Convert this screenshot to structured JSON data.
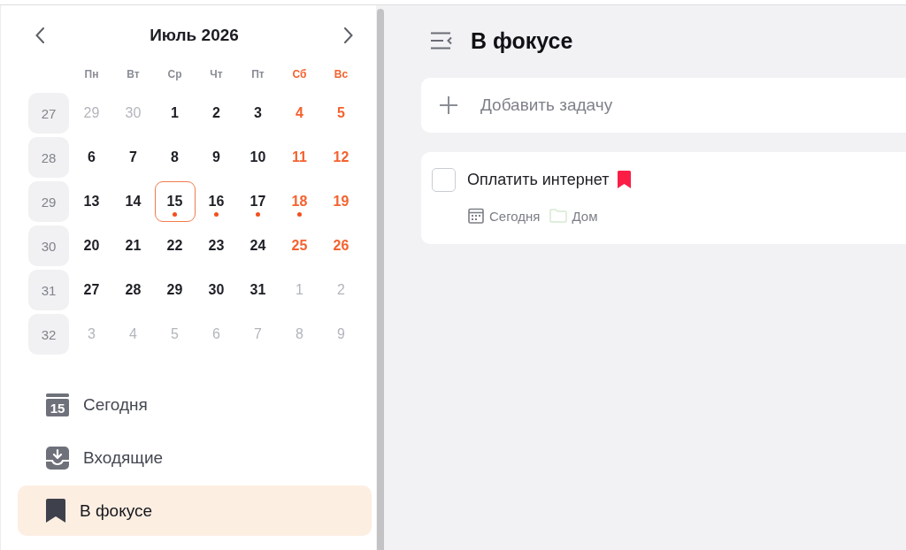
{
  "calendar": {
    "title": "Июль 2026",
    "weekdays": [
      {
        "label": "Пн",
        "kind": "weekday"
      },
      {
        "label": "Вт",
        "kind": "weekday"
      },
      {
        "label": "Ср",
        "kind": "weekday"
      },
      {
        "label": "Чт",
        "kind": "weekday"
      },
      {
        "label": "Пт",
        "kind": "weekday"
      },
      {
        "label": "Сб",
        "kind": "weekend"
      },
      {
        "label": "Вс",
        "kind": "weekend"
      }
    ],
    "weeks": [
      {
        "number": "27",
        "days": [
          {
            "label": "29",
            "kind": "other",
            "selected": false,
            "has_tasks": false
          },
          {
            "label": "30",
            "kind": "other",
            "selected": false,
            "has_tasks": false
          },
          {
            "label": "1",
            "kind": "weekday",
            "selected": false,
            "has_tasks": false
          },
          {
            "label": "2",
            "kind": "weekday",
            "selected": false,
            "has_tasks": false
          },
          {
            "label": "3",
            "kind": "weekday",
            "selected": false,
            "has_tasks": false
          },
          {
            "label": "4",
            "kind": "weekend",
            "selected": false,
            "has_tasks": false
          },
          {
            "label": "5",
            "kind": "weekend",
            "selected": false,
            "has_tasks": false
          }
        ]
      },
      {
        "number": "28",
        "days": [
          {
            "label": "6",
            "kind": "weekday",
            "selected": false,
            "has_tasks": false
          },
          {
            "label": "7",
            "kind": "weekday",
            "selected": false,
            "has_tasks": false
          },
          {
            "label": "8",
            "kind": "weekday",
            "selected": false,
            "has_tasks": false
          },
          {
            "label": "9",
            "kind": "weekday",
            "selected": false,
            "has_tasks": false
          },
          {
            "label": "10",
            "kind": "weekday",
            "selected": false,
            "has_tasks": false
          },
          {
            "label": "11",
            "kind": "weekend",
            "selected": false,
            "has_tasks": false
          },
          {
            "label": "12",
            "kind": "weekend",
            "selected": false,
            "has_tasks": false
          }
        ]
      },
      {
        "number": "29",
        "days": [
          {
            "label": "13",
            "kind": "weekday",
            "selected": false,
            "has_tasks": false
          },
          {
            "label": "14",
            "kind": "weekday",
            "selected": false,
            "has_tasks": false
          },
          {
            "label": "15",
            "kind": "weekday",
            "selected": true,
            "has_tasks": true
          },
          {
            "label": "16",
            "kind": "weekday",
            "selected": false,
            "has_tasks": true
          },
          {
            "label": "17",
            "kind": "weekday",
            "selected": false,
            "has_tasks": true
          },
          {
            "label": "18",
            "kind": "weekend",
            "selected": false,
            "has_tasks": true
          },
          {
            "label": "19",
            "kind": "weekend",
            "selected": false,
            "has_tasks": false
          }
        ]
      },
      {
        "number": "30",
        "days": [
          {
            "label": "20",
            "kind": "weekday",
            "selected": false,
            "has_tasks": false
          },
          {
            "label": "21",
            "kind": "weekday",
            "selected": false,
            "has_tasks": false
          },
          {
            "label": "22",
            "kind": "weekday",
            "selected": false,
            "has_tasks": false
          },
          {
            "label": "23",
            "kind": "weekday",
            "selected": false,
            "has_tasks": false
          },
          {
            "label": "24",
            "kind": "weekday",
            "selected": false,
            "has_tasks": false
          },
          {
            "label": "25",
            "kind": "weekend",
            "selected": false,
            "has_tasks": false
          },
          {
            "label": "26",
            "kind": "weekend",
            "selected": false,
            "has_tasks": false
          }
        ]
      },
      {
        "number": "31",
        "days": [
          {
            "label": "27",
            "kind": "weekday",
            "selected": false,
            "has_tasks": false
          },
          {
            "label": "28",
            "kind": "weekday",
            "selected": false,
            "has_tasks": false
          },
          {
            "label": "29",
            "kind": "weekday",
            "selected": false,
            "has_tasks": false
          },
          {
            "label": "30",
            "kind": "weekday",
            "selected": false,
            "has_tasks": false
          },
          {
            "label": "31",
            "kind": "weekday",
            "selected": false,
            "has_tasks": false
          },
          {
            "label": "1",
            "kind": "other",
            "selected": false,
            "has_tasks": false
          },
          {
            "label": "2",
            "kind": "other",
            "selected": false,
            "has_tasks": false
          }
        ]
      },
      {
        "number": "32",
        "days": [
          {
            "label": "3",
            "kind": "other",
            "selected": false,
            "has_tasks": false
          },
          {
            "label": "4",
            "kind": "other",
            "selected": false,
            "has_tasks": false
          },
          {
            "label": "5",
            "kind": "other",
            "selected": false,
            "has_tasks": false
          },
          {
            "label": "6",
            "kind": "other",
            "selected": false,
            "has_tasks": false
          },
          {
            "label": "7",
            "kind": "other",
            "selected": false,
            "has_tasks": false
          },
          {
            "label": "8",
            "kind": "other",
            "selected": false,
            "has_tasks": false
          },
          {
            "label": "9",
            "kind": "other",
            "selected": false,
            "has_tasks": false
          }
        ]
      }
    ]
  },
  "sidebar": {
    "items": [
      {
        "label": "Сегодня",
        "kind": "today",
        "icon_text": "15",
        "selected": false
      },
      {
        "label": "Входящие",
        "kind": "inbox",
        "selected": false
      },
      {
        "label": "В фокусе",
        "kind": "focus",
        "selected": true
      }
    ]
  },
  "main": {
    "title": "В фокусе",
    "add_task": {
      "placeholder": "Добавить задачу"
    },
    "tasks": [
      {
        "title": "Оплатить интернет",
        "checked": false,
        "flagged": true,
        "due": "Сегодня",
        "list": {
          "name": "Дом",
          "color": "#d6ead2"
        }
      }
    ]
  }
}
